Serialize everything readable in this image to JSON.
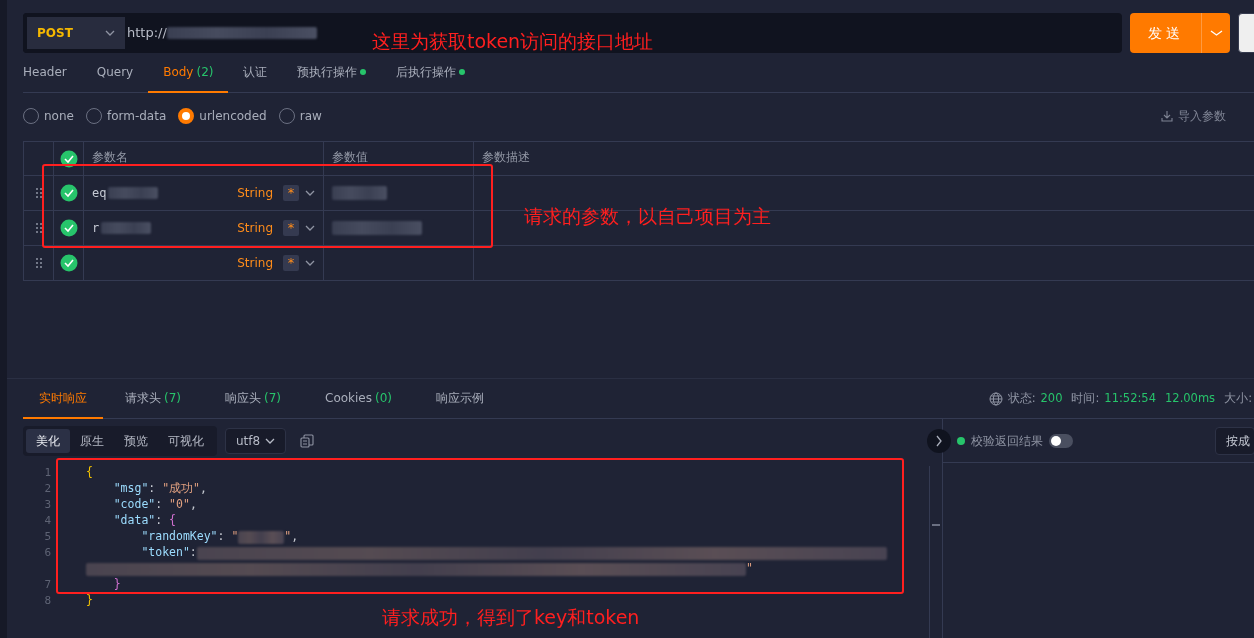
{
  "request": {
    "method": "POST",
    "url": "http://",
    "send_label": "发送"
  },
  "request_tabs": [
    {
      "label": "Header",
      "selected": false,
      "dot": false
    },
    {
      "label": "Query",
      "selected": false,
      "dot": false
    },
    {
      "label": "Body",
      "count": "(2)",
      "selected": true,
      "dot": false
    },
    {
      "label": "认证",
      "selected": false,
      "dot": false
    },
    {
      "label": "预执行操作",
      "selected": false,
      "dot": true
    },
    {
      "label": "后执行操作",
      "selected": false,
      "dot": true
    }
  ],
  "body_types": [
    {
      "label": "none",
      "selected": false
    },
    {
      "label": "form-data",
      "selected": false
    },
    {
      "label": "urlencoded",
      "selected": true
    },
    {
      "label": "raw",
      "selected": false
    }
  ],
  "import_label": "导入参数",
  "params_table": {
    "header_checked": true,
    "columns": [
      "参数名",
      "参数值",
      "参数描述"
    ],
    "rows": [
      {
        "checked": true,
        "name": "eq",
        "name_redacted": true,
        "type": "String",
        "required": "*",
        "value_redacted": true
      },
      {
        "checked": true,
        "name": "r",
        "name_redacted": true,
        "type": "String",
        "required": "*",
        "value_redacted": true
      },
      {
        "checked": true,
        "type": "String",
        "required": "*"
      }
    ]
  },
  "response_tabs": [
    {
      "label": "实时响应",
      "selected": true
    },
    {
      "label": "请求头",
      "count": "(7)",
      "selected": false
    },
    {
      "label": "响应头",
      "count": "(7)",
      "selected": false
    },
    {
      "label": "Cookies",
      "count": "(0)",
      "selected": false
    },
    {
      "label": "响应示例",
      "selected": false
    }
  ],
  "status": {
    "status_label": "状态:",
    "status": "200",
    "time_label": "时间:",
    "time": "11:52:54",
    "duration": "12.00ms",
    "size_label": "大小:"
  },
  "view_modes": [
    {
      "label": "美化",
      "selected": true
    },
    {
      "label": "原生",
      "selected": false
    },
    {
      "label": "预览",
      "selected": false
    },
    {
      "label": "可视化",
      "selected": false
    }
  ],
  "encoding": "utf8",
  "validate": {
    "label": "校验返回结果",
    "on": false
  },
  "partial_button": "按成",
  "code_lines": [
    {
      "number": "1",
      "parts": [
        {
          "kind": "brace",
          "text": "{"
        }
      ]
    },
    {
      "number": "2",
      "parts": [
        {
          "kind": "key",
          "text": "    \"msg\""
        },
        {
          "kind": "punct",
          "text": ": "
        },
        {
          "kind": "string",
          "text": "\"成功\""
        },
        {
          "kind": "punct",
          "text": ","
        }
      ]
    },
    {
      "number": "3",
      "parts": [
        {
          "kind": "key",
          "text": "    \"code\""
        },
        {
          "kind": "punct",
          "text": ": "
        },
        {
          "kind": "string",
          "text": "\"0\""
        },
        {
          "kind": "punct",
          "text": ","
        }
      ]
    },
    {
      "number": "4",
      "parts": [
        {
          "kind": "key",
          "text": "    \"data\""
        },
        {
          "kind": "punct",
          "text": ": "
        },
        {
          "kind": "brace2",
          "text": "{"
        }
      ]
    },
    {
      "number": "5",
      "parts": [
        {
          "kind": "key",
          "text": "        \"randomKey\""
        },
        {
          "kind": "punct",
          "text": ": "
        },
        {
          "kind": "string",
          "text": "\""
        },
        {
          "kind": "blur-short"
        },
        {
          "kind": "string",
          "text": "\""
        },
        {
          "kind": "punct",
          "text": ","
        }
      ]
    },
    {
      "number": "6",
      "parts": [
        {
          "kind": "key",
          "text": "        \"token\""
        },
        {
          "kind": "punct",
          "text": ":"
        },
        {
          "kind": "blur-long"
        }
      ]
    },
    {
      "parts": [
        {
          "kind": "blur-wrap"
        },
        {
          "kind": "string",
          "text": "\""
        }
      ]
    },
    {
      "number": "7",
      "parts": [
        {
          "kind": "brace2",
          "text": "    }"
        }
      ]
    },
    {
      "number": "8",
      "parts": [
        {
          "kind": "brace",
          "text": "}"
        }
      ]
    }
  ],
  "annotations": [
    {
      "text": "这里为获取token访问的接口地址"
    },
    {
      "text": "请求的参数，以自己项目为主"
    },
    {
      "text": "请求成功，得到了key和token"
    }
  ]
}
